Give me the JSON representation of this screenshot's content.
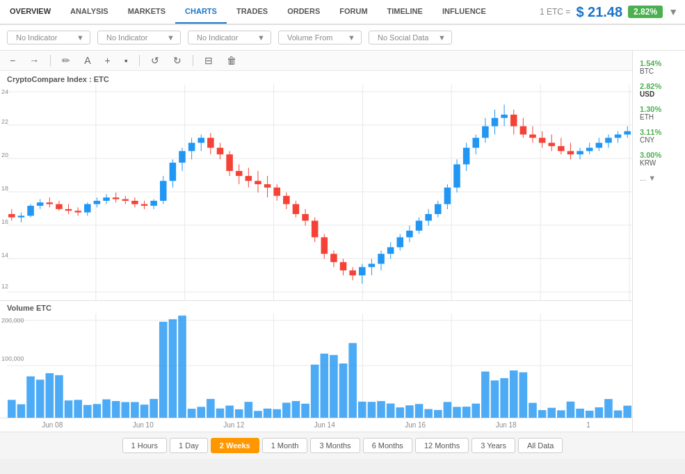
{
  "nav": {
    "tabs": [
      {
        "label": "OVERVIEW",
        "active": false
      },
      {
        "label": "ANALYSIS",
        "active": false
      },
      {
        "label": "MARKETS",
        "active": false
      },
      {
        "label": "CHARTS",
        "active": true
      },
      {
        "label": "TRADES",
        "active": false
      },
      {
        "label": "ORDERS",
        "active": false
      },
      {
        "label": "FORUM",
        "active": false
      },
      {
        "label": "TIMELINE",
        "active": false
      },
      {
        "label": "INFLUENCE",
        "active": false
      }
    ],
    "price_label": "1 ETC =",
    "price_value": "$ 21.48",
    "price_change": "2.82%",
    "dropdown_arrow": "▼"
  },
  "indicators": [
    {
      "label": "No Indicator"
    },
    {
      "label": "No Indicator"
    },
    {
      "label": "No Indicator"
    },
    {
      "label": "Volume From"
    },
    {
      "label": "No Social Data"
    }
  ],
  "toolbar": {
    "tools": [
      "−",
      "→",
      "✏",
      "A",
      "+",
      "▪",
      "↺",
      "↻",
      "⊟",
      "🗑"
    ]
  },
  "chart": {
    "title": "CryptoCompare Index : ETC",
    "volume_title": "Volume ETC",
    "y_labels_price": [
      "24",
      "22",
      "20",
      "18",
      "16",
      "14",
      "12"
    ],
    "y_labels_volume": [
      "200,000",
      "100,000"
    ],
    "x_labels": [
      "Jun 08",
      "Jun 10",
      "Jun 12",
      "Jun 14",
      "Jun 16",
      "Jun 18",
      "1"
    ]
  },
  "currencies": [
    {
      "pct": "1.54%",
      "name": "BTC"
    },
    {
      "pct": "2.82%",
      "name": "USD",
      "highlighted": true
    },
    {
      "pct": "1.30%",
      "name": "ETH"
    },
    {
      "pct": "3.11%",
      "name": "CNY"
    },
    {
      "pct": "3.00%",
      "name": "KRW"
    },
    {
      "label": "... ▼"
    }
  ],
  "time_periods": [
    {
      "label": "1 Hours",
      "active": false
    },
    {
      "label": "1 Day",
      "active": false
    },
    {
      "label": "2 Weeks",
      "active": true
    },
    {
      "label": "1 Month",
      "active": false
    },
    {
      "label": "3 Months",
      "active": false
    },
    {
      "label": "6 Months",
      "active": false
    },
    {
      "label": "12 Months",
      "active": false
    },
    {
      "label": "3 Years",
      "active": false
    },
    {
      "label": "All Data",
      "active": false
    }
  ]
}
